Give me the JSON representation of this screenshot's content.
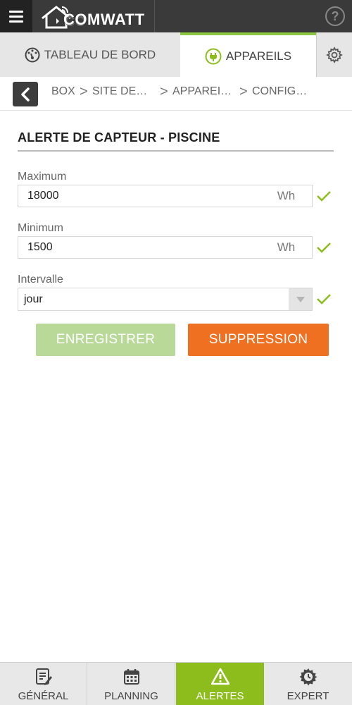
{
  "header": {
    "logo_text": "COMWATT",
    "help_label": "?"
  },
  "tabs": {
    "dashboard_label": "TABLEAU DE BORD",
    "devices_label": "APPAREILS"
  },
  "breadcrumb": [
    "BOX",
    "SITE DE…",
    "APPAREI…",
    "CONFIG…"
  ],
  "breadcrumb_separator": ">",
  "section": {
    "title": "ALERTE DE CAPTEUR - PISCINE"
  },
  "form": {
    "maximum": {
      "label": "Maximum",
      "value": "18000",
      "unit": "Wh"
    },
    "minimum": {
      "label": "Minimum",
      "value": "1500",
      "unit": "Wh"
    },
    "interval": {
      "label": "Intervalle",
      "value": "jour"
    }
  },
  "buttons": {
    "save_label": "ENREGISTRER",
    "delete_label": "SUPPRESSION"
  },
  "bottom_nav": {
    "general": "GÉNÉRAL",
    "planning": "PLANNING",
    "alerts": "ALERTES",
    "expert": "EXPERT"
  },
  "colors": {
    "accent_green": "#8cbd1c",
    "save_button": "#b9d999",
    "delete_button": "#f07022",
    "check": "#8cbd1c"
  },
  "icons": {
    "menu": "hamburger-icon",
    "help": "help-icon",
    "dashboard": "gauge-icon",
    "devices": "plug-icon",
    "settings": "gear-icon",
    "back": "chevron-left-icon",
    "valid": "check-icon",
    "dropdown": "triangle-down-icon",
    "general": "document-edit-icon",
    "planning": "calendar-icon",
    "alerts": "warning-icon",
    "expert": "expert-gear-icon"
  }
}
